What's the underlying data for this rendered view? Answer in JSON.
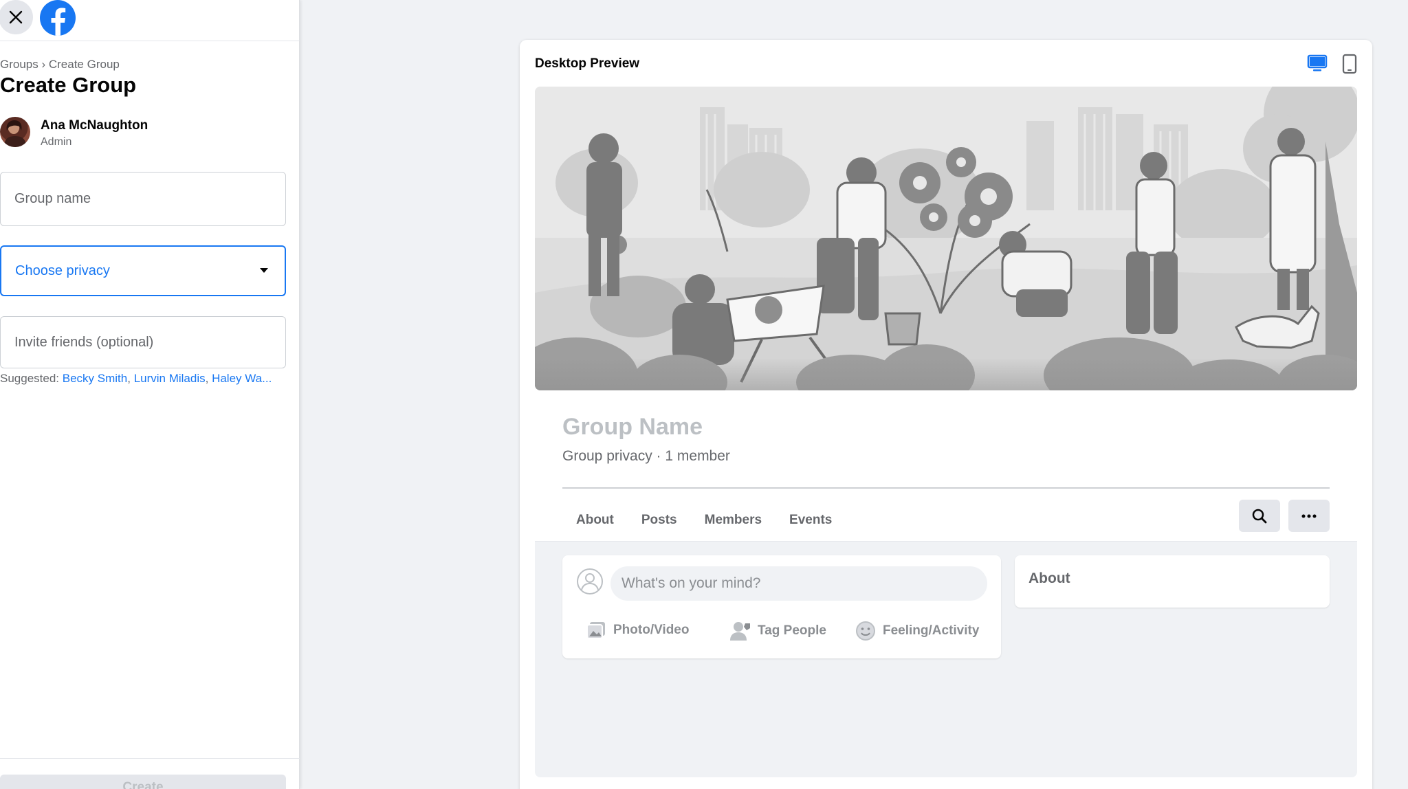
{
  "left_panel": {
    "breadcrumb": "Groups › Create Group",
    "title": "Create Group",
    "admin": {
      "name": "Ana McNaughton",
      "role": "Admin"
    },
    "group_name_placeholder": "Group name",
    "privacy_placeholder": "Choose privacy",
    "invite_placeholder": "Invite friends (optional)",
    "suggested_label": "Suggested:",
    "suggested_people": [
      "Becky Smith",
      "Lurvin Miladis",
      "Haley Wa..."
    ],
    "create_label": "Create"
  },
  "preview": {
    "title": "Desktop Preview",
    "group_name": "Group Name",
    "meta": "Group privacy · 1 member",
    "tabs": [
      "About",
      "Posts",
      "Members",
      "Events"
    ],
    "composer_placeholder": "What's on your mind?",
    "actions": [
      "Photo/Video",
      "Tag People",
      "Feeling/Activity"
    ],
    "about_title": "About"
  },
  "colors": {
    "accent": "#1877f2",
    "background": "#f0f2f5",
    "muted_text": "#65676b"
  },
  "icons": [
    "close-icon",
    "facebook-logo-icon",
    "chevron-down-icon",
    "desktop-icon",
    "mobile-icon",
    "search-icon",
    "more-icon",
    "user-icon",
    "photo-icon",
    "tag-people-icon",
    "feeling-icon"
  ]
}
